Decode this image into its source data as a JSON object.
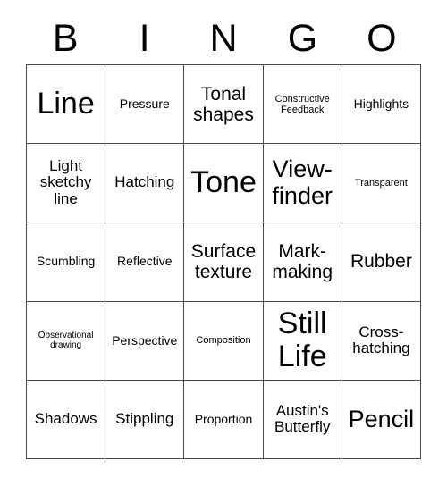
{
  "card": {
    "title_letters": [
      "B",
      "I",
      "N",
      "G",
      "O"
    ],
    "rows": [
      [
        {
          "label": "Line",
          "size": "fs-xxl"
        },
        {
          "label": "Pressure",
          "size": "fs-s"
        },
        {
          "label": "Tonal shapes",
          "size": "fs-l"
        },
        {
          "label": "Constructive Feedback",
          "size": "fs-xs"
        },
        {
          "label": "Highlights",
          "size": "fs-s"
        }
      ],
      [
        {
          "label": "Light sketchy line",
          "size": "fs-m"
        },
        {
          "label": "Hatching",
          "size": "fs-m"
        },
        {
          "label": "Tone",
          "size": "fs-xxl"
        },
        {
          "label": "View-finder",
          "size": "fs-xl"
        },
        {
          "label": "Transparent",
          "size": "fs-xs"
        }
      ],
      [
        {
          "label": "Scumbling",
          "size": "fs-s"
        },
        {
          "label": "Reflective",
          "size": "fs-s"
        },
        {
          "label": "Surface texture",
          "size": "fs-l"
        },
        {
          "label": "Mark-making",
          "size": "fs-l"
        },
        {
          "label": "Rubber",
          "size": "fs-l"
        }
      ],
      [
        {
          "label": "Observational drawing",
          "size": "fs-xxs"
        },
        {
          "label": "Perspective",
          "size": "fs-s"
        },
        {
          "label": "Composition",
          "size": "fs-xs"
        },
        {
          "label": "Still Life",
          "size": "fs-xxl"
        },
        {
          "label": "Cross-hatching",
          "size": "fs-m"
        }
      ],
      [
        {
          "label": "Shadows",
          "size": "fs-m"
        },
        {
          "label": "Stippling",
          "size": "fs-m"
        },
        {
          "label": "Proportion",
          "size": "fs-s"
        },
        {
          "label": "Austin's Butterfly",
          "size": "fs-m"
        },
        {
          "label": "Pencil",
          "size": "fs-xl"
        }
      ]
    ],
    "colors": {
      "background": "#ffffff",
      "text": "#000000",
      "grid_line": "#4a4a4a"
    }
  }
}
